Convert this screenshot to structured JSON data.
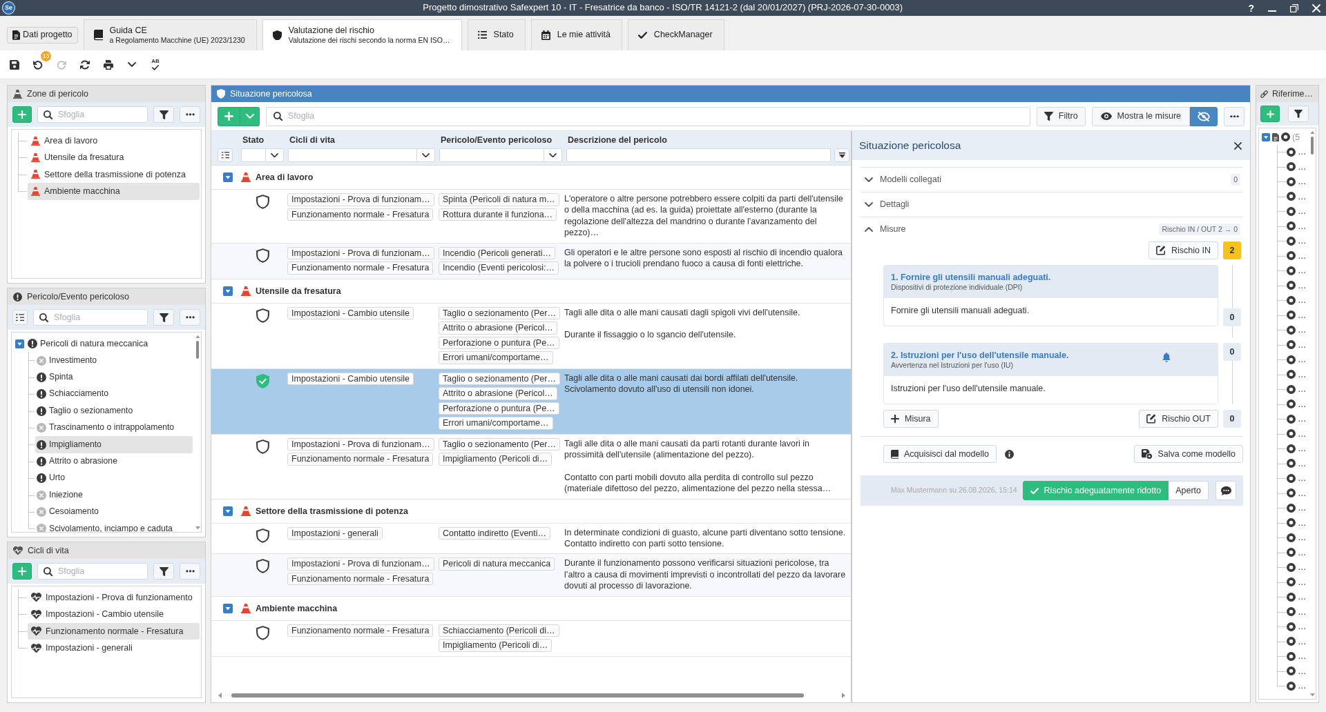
{
  "window": {
    "logo": "Se",
    "title": "Progetto dimostrativo Safexpert 10 - IT - Fresatrice da banco - ISO/TR 14121-2 (dal 20/01/2027) (PRJ-2026-07-30-0003)",
    "help": "?"
  },
  "tabs": [
    {
      "kind": "button",
      "label": "Dati progetto",
      "selected": false
    },
    {
      "kind": "tab",
      "label": "Guida CE",
      "subtitle": "a Regolamento Macchine (UE) 2023/1230",
      "selected": false
    },
    {
      "kind": "tab",
      "label": "Valutazione del rischio",
      "subtitle": "Valutazione dei rischi secondo la norma EN ISO…",
      "selected": true
    },
    {
      "kind": "tab",
      "label": "Stato",
      "selected": false
    },
    {
      "kind": "tab",
      "label": "Le mie attività",
      "selected": false
    },
    {
      "kind": "tab",
      "label": "CheckManager",
      "selected": false
    }
  ],
  "toolbar": [
    {
      "disabled": false
    },
    {
      "disabled": false,
      "badge": "13"
    },
    {
      "disabled": true
    },
    {
      "disabled": false
    },
    {
      "disabled": false
    },
    {
      "disabled": false
    },
    {
      "disabled": false,
      "label": "AB"
    }
  ],
  "left_panels": [
    {
      "kind": "zones",
      "title": "Zone di pericolo",
      "search": {
        "placeholder": "Sfoglia"
      },
      "items": [
        {
          "label": "Area di lavoro",
          "selected": false
        },
        {
          "label": "Utensile da fresatura",
          "selected": false
        },
        {
          "label": "Settore della trasmissione di potenza",
          "selected": false
        },
        {
          "label": "Ambiente macchina",
          "selected": true
        }
      ]
    },
    {
      "kind": "hazards",
      "title": "Pericolo/Evento pericoloso",
      "search": {
        "placeholder": "Sfoglia"
      },
      "items": [
        {
          "label": "Pericoli di natura meccanica",
          "assigned": true,
          "selected": false,
          "expanded": true,
          "children": [
            {
              "label": "Investimento",
              "assigned": false,
              "selected": false
            },
            {
              "label": "Spinta",
              "assigned": true,
              "selected": false
            },
            {
              "label": "Schiacciamento",
              "assigned": true,
              "selected": false
            },
            {
              "label": "Taglio o sezionamento",
              "assigned": true,
              "selected": false
            },
            {
              "label": "Trascinamento o intrappolamento",
              "assigned": false,
              "selected": false
            },
            {
              "label": "Impigliamento",
              "assigned": true,
              "selected": true
            },
            {
              "label": "Attrito o abrasione",
              "assigned": true,
              "selected": false
            },
            {
              "label": "Urto",
              "assigned": true,
              "selected": false
            },
            {
              "label": "Iniezione",
              "assigned": false,
              "selected": false
            },
            {
              "label": "Cesoiamento",
              "assigned": false,
              "selected": false
            },
            {
              "label": "Scivolamento, inciampo e caduta",
              "assigned": false,
              "selected": false
            }
          ]
        }
      ]
    },
    {
      "kind": "lifecycles",
      "title": "Cicli di vita",
      "search": {
        "placeholder": "Sfoglia"
      },
      "items": [
        {
          "label": "Impostazioni - Prova di funzionamento",
          "selected": false
        },
        {
          "label": "Impostazioni - Cambio utensile",
          "selected": false
        },
        {
          "label": "Funzionamento normale - Fresatura",
          "selected": true
        },
        {
          "label": "Impostazioni - generali",
          "selected": false
        }
      ]
    }
  ],
  "hazard_situations": {
    "title": "Situazione pericolosa",
    "toolbar": {
      "search": {
        "placeholder": "Sfoglia"
      },
      "filter": "Filtro",
      "show_measures": "Mostra le misure",
      "hide_measures_on": true
    },
    "table": {
      "columns": [
        {
          "label": "Stato",
          "dropdown": true
        },
        {
          "label": "Cicli di vita",
          "dropdown": true
        },
        {
          "label": "Pericolo/Evento pericoloso",
          "dropdown": true
        },
        {
          "label": "Descrizione del pericolo",
          "dropdown": false
        }
      ],
      "groups": [
        {
          "label": "Area di lavoro",
          "expanded": true,
          "rows": [
            {
              "mitigated": false,
              "selected": false,
              "lifecycles": [
                "Impostazioni - Prova di funzionam…",
                "Funzionamento normale - Fresatura"
              ],
              "hazards": [
                "Spinta (Pericoli di natura m…",
                "Rottura durante il funziona…"
              ],
              "description": "L'operatore o altre persone potrebbero essere colpiti da parti dell'utensile o della macchina (ad es. la guida) proiettate all'esterno (durante la regolazione dell'altezza del mandrino o durante l'avanzamento del pezzo)…"
            },
            {
              "mitigated": false,
              "selected": false,
              "lifecycles": [
                "Impostazioni - Prova di funzionam…",
                "Funzionamento normale - Fresatura"
              ],
              "hazards": [
                "Incendio (Pericoli generati…",
                "Incendio (Eventi pericolosi:…"
              ],
              "description": "Gli operatori e le altre persone sono esposti al rischio di incendio qualora la polvere o i trucioli prendano fuoco a causa di fonti elettriche."
            }
          ]
        },
        {
          "label": "Utensile da fresatura",
          "expanded": true,
          "rows": [
            {
              "mitigated": false,
              "selected": false,
              "lifecycles": [
                "Impostazioni - Cambio utensile"
              ],
              "hazards": [
                "Taglio o sezionamento (Per…",
                "Attrito o abrasione (Pericol…",
                "Perforazione o puntura (Pe…",
                "Errori umani/comportame…"
              ],
              "description": "Tagli alle dita o alle mani causati dagli spigoli vivi dell'utensile.\n\nDurante il fissaggio o lo sgancio dell'utensile."
            },
            {
              "mitigated": true,
              "selected": true,
              "lifecycles": [
                "Impostazioni - Cambio utensile"
              ],
              "hazards": [
                "Taglio o sezionamento (Per…",
                "Attrito o abrasione (Pericol…",
                "Perforazione o puntura (Pe…",
                "Errori umani/comportame…"
              ],
              "description": "Tagli alle dita o alle mani causati dai bordi affilati dell'utensile.\nScivolamento dovuto all'uso di utensili non idonei."
            },
            {
              "mitigated": false,
              "selected": false,
              "lifecycles": [
                "Impostazioni - Prova di funzionam…",
                "Funzionamento normale - Fresatura"
              ],
              "hazards": [
                "Taglio o sezionamento (Per…",
                "Impigliamento (Pericoli di…"
              ],
              "description": "Tagli alle dita o alle mani causati da parti rotanti durante lavori in prossimità dell'utensile (alimentazione del pezzo).\n\nContatto con parti mobili dovuto alla perdita di controllo sul pezzo (materiale difettoso del pezzo, alimentazione del pezzo nella stessa…"
            }
          ]
        },
        {
          "label": "Settore della trasmissione di potenza",
          "expanded": true,
          "rows": [
            {
              "mitigated": false,
              "selected": false,
              "lifecycles": [
                "Impostazioni - generali"
              ],
              "hazards": [
                "Contatto indiretto (Eventi…"
              ],
              "description": "In determinate condizioni di guasto, alcune parti diventano sotto tensione.\nContatto indiretto con parti sotto tensione."
            },
            {
              "mitigated": false,
              "selected": false,
              "lifecycles": [
                "Impostazioni - Prova di funzionam…",
                "Funzionamento normale - Fresatura"
              ],
              "hazards": [
                "Pericoli di natura meccanica"
              ],
              "description": "Durante il funzionamento possono verificarsi situazioni pericolose, tra l’altro a causa di movimenti imprevisti o incontrollati del pezzo da lavorare dovuti al processo di lavorazione."
            }
          ]
        },
        {
          "label": "Ambiente macchina",
          "expanded": true,
          "rows": [
            {
              "mitigated": false,
              "selected": false,
              "lifecycles": [
                "Funzionamento normale - Fresatura"
              ],
              "hazards": [
                "Schiacciamento (Pericoli di…",
                "Impigliamento (Pericoli di…"
              ]
            }
          ]
        }
      ]
    },
    "detail": {
      "title": "Situazione pericolosa",
      "sections": [
        {
          "label": "Modelli collegati",
          "expanded": false,
          "count": "0"
        },
        {
          "label": "Dettagli",
          "expanded": false
        },
        {
          "label": "Misure",
          "expanded": true,
          "summary": "Rischio IN / OUT 2 → 0",
          "risk_in": {
            "label": "Rischio IN",
            "value": "2",
            "color": "#f8c21c"
          },
          "measures": [
            {
              "title": "1. Fornire gli utensili manuali adeguati.",
              "category": "Dispositivi di protezione individuale (DPI)",
              "text": "Fornire gli utensili manuali adeguati.",
              "risk": "0",
              "color": "#e6ecf3",
              "notify": false
            },
            {
              "title": "2. Istruzioni per l'uso dell'utensile manuale.",
              "category": "Avvertenza nel Istruzioni per l'uso (IU)",
              "text": "Istruzioni per l'uso dell'utensile manuale.",
              "risk": "0",
              "color": "#e6ecf3",
              "notify": true
            }
          ],
          "add_measure": "Misura",
          "risk_out": {
            "label": "Rischio OUT",
            "value": "0",
            "color": "#e6ecf3"
          }
        }
      ],
      "template_buttons": [
        "Acquisisci dal modello",
        "Salva come modello"
      ],
      "footer": {
        "meta": "Max Mustermann su 26.08.2026, 15:14",
        "status_options": [
          {
            "label": "Rischio adeguatamente ridotto",
            "selected": true
          },
          {
            "label": "Aperto",
            "selected": false
          }
        ]
      }
    }
  },
  "references": {
    "title": "Riferime…",
    "root": {
      "label": "(5",
      "expanded": true,
      "children": [
        {
          "label": "…"
        },
        {
          "label": "…"
        },
        {
          "label": "…"
        },
        {
          "label": "…"
        },
        {
          "label": "…"
        },
        {
          "label": "…"
        },
        {
          "label": "…"
        },
        {
          "label": "…"
        },
        {
          "label": "…"
        },
        {
          "label": "…"
        },
        {
          "label": "…"
        },
        {
          "label": "…"
        },
        {
          "label": "…"
        },
        {
          "label": "…"
        },
        {
          "label": "…"
        },
        {
          "label": "…"
        },
        {
          "label": "…"
        },
        {
          "label": "…"
        },
        {
          "label": "…"
        },
        {
          "label": "…"
        },
        {
          "label": "…"
        },
        {
          "label": "…"
        },
        {
          "label": "…"
        },
        {
          "label": "…"
        },
        {
          "label": "…"
        },
        {
          "label": "…"
        },
        {
          "label": "…"
        },
        {
          "label": "…"
        },
        {
          "label": "…"
        },
        {
          "label": "…"
        },
        {
          "label": "…"
        },
        {
          "label": "…"
        },
        {
          "label": "…"
        },
        {
          "label": "…"
        },
        {
          "label": "…"
        },
        {
          "label": "…"
        },
        {
          "label": "…"
        }
      ]
    }
  }
}
